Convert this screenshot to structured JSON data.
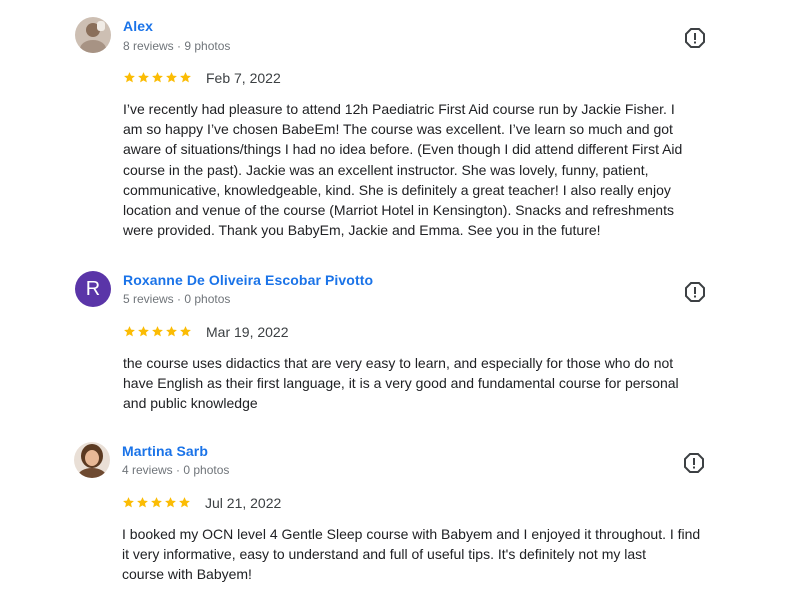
{
  "colors": {
    "author_link": "#1a73e8",
    "star": "#fbbc04",
    "avatar_letter_bg": "#5a35a8",
    "meta_text": "#70757a"
  },
  "reviews": [
    {
      "author": "Alex",
      "meta": "8 reviews · 9 photos",
      "rating": 5,
      "date": "Feb 7, 2022",
      "avatar_icon": "user-photo",
      "lines": [
        "I’ve recently had pleasure to attend 12h Paediatric First Aid course run by Jackie Fisher. I",
        "am so happy I’ve chosen BabeEm! The course was excellent. I’ve learn so much and got",
        "aware of situations/things I had no idea before. (Even though I did attend different First Aid",
        "course in the past). Jackie was an excellent instructor. She was lovely, funny, patient,",
        "communicative, knowledgeable, kind. She is definitely a great teacher! I also really enjoy",
        "location and venue of the course (Marriot Hotel in Kensington). Snacks and refreshments",
        "were provided. Thank you BabyEm, Jackie and Emma. See you in the future!"
      ]
    },
    {
      "author": "Roxanne De Oliveira Escobar Pivotto",
      "meta": "5 reviews · 0 photos",
      "rating": 5,
      "date": "Mar 19, 2022",
      "avatar_letter": "R",
      "lines": [
        "the course uses didactics that are very easy to learn, and especially for those who do not",
        "have English as their first language, it is a very good and fundamental course for personal",
        "and public knowledge"
      ]
    },
    {
      "author": "Martina Sarb",
      "meta": "4 reviews · 0 photos",
      "rating": 5,
      "date": "Jul 21, 2022",
      "avatar_icon": "user-photo",
      "lines": [
        "I booked my OCN level 4 Gentle Sleep course with Babyem and I enjoyed it throughout. I find",
        "it very informative, easy to understand and full of useful tips. It's definitely not my last",
        "course with Babyem!"
      ]
    }
  ]
}
